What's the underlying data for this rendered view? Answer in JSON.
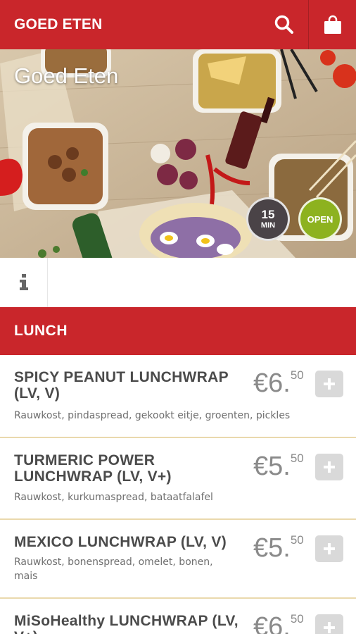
{
  "appbar": {
    "title": "GOED ETEN",
    "search_icon": "search-icon",
    "cart_icon": "shopping-bag-icon",
    "color": "#c9262b"
  },
  "hero": {
    "title": "Goed Eten",
    "delivery_time_value": "15",
    "delivery_time_unit": "MIN",
    "status": "OPEN"
  },
  "info": {
    "icon": "info-icon"
  },
  "category": {
    "title": "LUNCH"
  },
  "items": [
    {
      "name": "SPICY PEANUT LUNCHWRAP (LV, V)",
      "description": "Rauwkost, pindaspread, gekookt eitje, groenten, pickles",
      "price_main": "€6.",
      "price_cents": "50"
    },
    {
      "name": "TURMERIC POWER LUNCHWRAP (LV, V+)",
      "description": "Rauwkost, kurkumaspread, bataatfalafel",
      "price_main": "€5.",
      "price_cents": "50"
    },
    {
      "name": "MEXICO LUNCHWRAP (LV, V)",
      "description": "Rauwkost, bonenspread, omelet, bonen, mais",
      "price_main": "€5.",
      "price_cents": "50"
    },
    {
      "name": "MiSoHealthy LUNCHWRAP (LV, V+)",
      "description": "",
      "price_main": "€6.",
      "price_cents": "50"
    }
  ]
}
